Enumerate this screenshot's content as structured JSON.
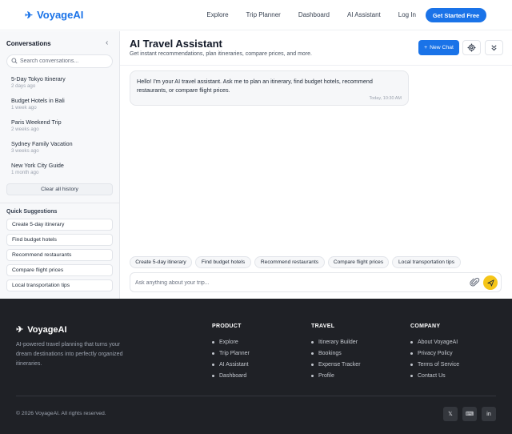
{
  "header": {
    "brand": "VoyageAI",
    "nav": [
      "Explore",
      "Trip Planner",
      "Dashboard",
      "AI Assistant",
      "Log In"
    ],
    "cta": "Get Started Free"
  },
  "sidebar": {
    "title": "Conversations",
    "search_placeholder": "Search conversations...",
    "conversations": [
      {
        "title": "5-Day Tokyo Itinerary",
        "time": "2 days ago"
      },
      {
        "title": "Budget Hotels in Bali",
        "time": "1 week ago"
      },
      {
        "title": "Paris Weekend Trip",
        "time": "2 weeks ago"
      },
      {
        "title": "Sydney Family Vacation",
        "time": "3 weeks ago"
      },
      {
        "title": "New York City Guide",
        "time": "1 month ago"
      }
    ],
    "clear_label": "Clear all history",
    "quick_title": "Quick Suggestions",
    "quick": [
      "Create 5-day itinerary",
      "Find budget hotels",
      "Recommend restaurants",
      "Compare flight prices",
      "Local transportation tips"
    ]
  },
  "main": {
    "title": "AI Travel Assistant",
    "subtitle": "Get instant recommendations, plan itineraries, compare prices, and more.",
    "new_chat": "New Chat",
    "message": "Hello! I'm your AI travel assistant. Ask me to plan an itinerary, find budget hotels, recommend restaurants, or compare flight prices.",
    "message_time": "Today, 10:30 AM",
    "chips": [
      "Create 5-day itinerary",
      "Find budget hotels",
      "Recommend restaurants",
      "Compare flight prices",
      "Local transportation tips"
    ],
    "input_placeholder": "Ask anything about your trip..."
  },
  "footer": {
    "brand": "VoyageAI",
    "description": "AI-powered travel planning that turns your dream destinations into perfectly organized itineraries.",
    "columns": [
      {
        "heading": "PRODUCT",
        "links": [
          "Explore",
          "Trip Planner",
          "AI Assistant",
          "Dashboard"
        ]
      },
      {
        "heading": "TRAVEL",
        "links": [
          "Itinerary Builder",
          "Bookings",
          "Expense Tracker",
          "Profile"
        ]
      },
      {
        "heading": "COMPANY",
        "links": [
          "About VoyageAI",
          "Privacy Policy",
          "Terms of Service",
          "Contact Us"
        ]
      }
    ],
    "copyright": "© 2026 VoyageAI. All rights reserved.",
    "social": [
      "𝕏",
      "⌨",
      "in"
    ]
  },
  "colors": {
    "accent": "#1a73e8",
    "send": "#f5c518",
    "footer_bg": "#1f2126"
  },
  "icons": [
    "plane-icon",
    "chevron-left-icon",
    "search-icon",
    "plus-icon",
    "gear-icon",
    "chevrons-down-icon",
    "paperclip-icon",
    "send-icon"
  ]
}
